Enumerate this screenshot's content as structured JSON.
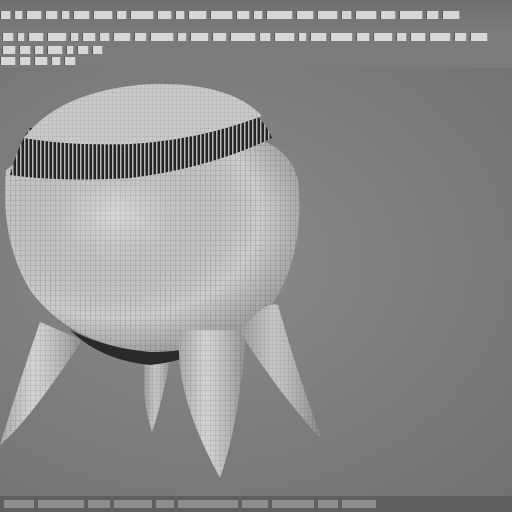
{
  "app": {
    "window_title": "",
    "menu_labels": [
      "",
      "",
      "",
      "",
      "",
      "",
      "",
      "",
      "",
      "",
      "",
      "",
      "",
      "",
      "",
      "",
      "",
      "",
      "",
      "",
      "",
      "",
      ""
    ],
    "toolbar_row_labels": [
      "",
      "",
      ""
    ]
  },
  "viewport": {
    "object_name": "",
    "display_mode": "wireframe-on-shaded"
  },
  "colors": {
    "background": "#7b7b7b",
    "mesh_fill": "#c9c9c9",
    "wire": "#8a8a8a",
    "band_dark": "#2b2b2b"
  },
  "status": {
    "text": ""
  }
}
